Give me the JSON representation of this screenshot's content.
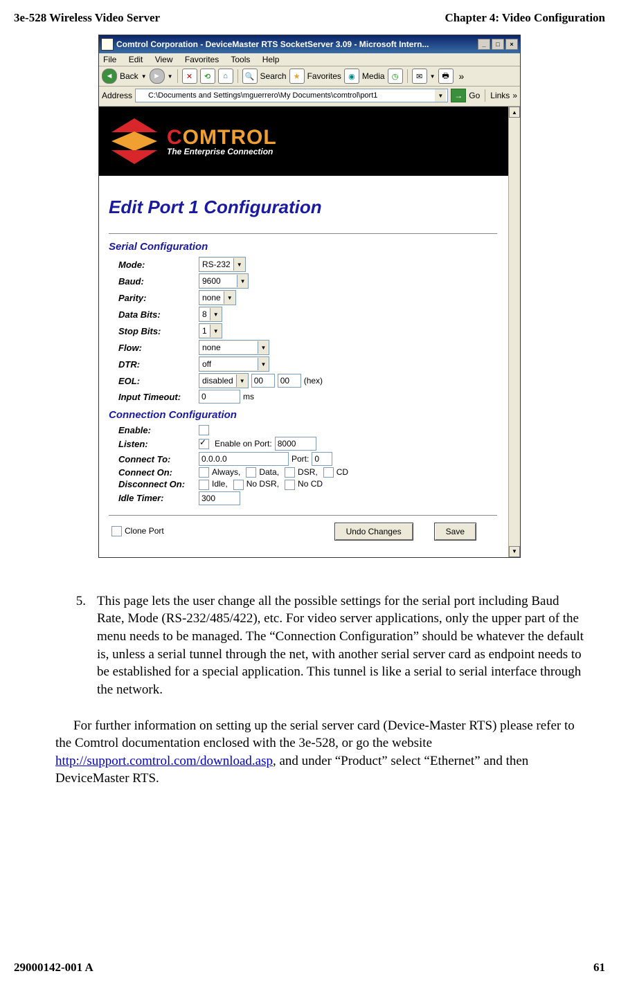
{
  "header": {
    "left": "3e-528 Wireless Video Server",
    "right": "Chapter 4: Video Configuration"
  },
  "browser": {
    "title": "Comtrol Corporation - DeviceMaster RTS SocketServer 3.09 - Microsoft Intern...",
    "menus": [
      "File",
      "Edit",
      "View",
      "Favorites",
      "Tools",
      "Help"
    ],
    "toolbar": {
      "back": "Back",
      "search": "Search",
      "favorites": "Favorites",
      "media": "Media"
    },
    "address": {
      "label": "Address",
      "value": "C:\\Documents and Settings\\mguerrero\\My Documents\\comtrol\\port1",
      "go": "Go",
      "links": "Links"
    }
  },
  "logo": {
    "brand": "COMTROL",
    "tagline": "The Enterprise Connection"
  },
  "form": {
    "heading": "Edit Port 1 Configuration",
    "section_serial": "Serial Configuration",
    "mode": {
      "label": "Mode:",
      "value": "RS-232"
    },
    "baud": {
      "label": "Baud:",
      "value": "9600"
    },
    "parity": {
      "label": "Parity:",
      "value": "none"
    },
    "databits": {
      "label": "Data Bits:",
      "value": "8"
    },
    "stopbits": {
      "label": "Stop Bits:",
      "value": "1"
    },
    "flow": {
      "label": "Flow:",
      "value": "none"
    },
    "dtr": {
      "label": "DTR:",
      "value": "off"
    },
    "eol": {
      "label": "EOL:",
      "value": "disabled",
      "hex1": "00",
      "hex2": "00",
      "suffix": "(hex)"
    },
    "timeout": {
      "label": "Input Timeout:",
      "value": "0",
      "suffix": "ms"
    },
    "section_conn": "Connection Configuration",
    "enable": {
      "label": "Enable:"
    },
    "listen": {
      "label": "Listen:",
      "cb_label": "Enable on Port:",
      "port": "8000"
    },
    "connect_to": {
      "label": "Connect To:",
      "ip": "0.0.0.0",
      "port_label": "Port:",
      "port": "0"
    },
    "connect_on": {
      "label": "Connect On:",
      "o1": "Always,",
      "o2": "Data,",
      "o3": "DSR,",
      "o4": "CD"
    },
    "disconnect_on": {
      "label": "Disconnect On:",
      "o1": "Idle,",
      "o2": "No DSR,",
      "o3": "No CD"
    },
    "idle": {
      "label": "Idle Timer:",
      "value": "300"
    },
    "clone": "Clone Port",
    "undo": "Undo Changes",
    "save": "Save"
  },
  "paragraph5": {
    "num": "5.",
    "text": "This page lets the user change all the possible settings for the serial port including Baud Rate, Mode (RS-232/485/422), etc. For video server applications, only the upper part of the menu needs to be managed. The “Connection Configuration” should be whatever the default is, unless a serial tunnel through the net, with another serial server card as endpoint needs to be established for a special application. This tunnel is like a serial to serial interface through the network."
  },
  "para_end": {
    "pre": "For further information on setting up the serial server card (Device-Master RTS) please refer to the Comtrol documentation enclosed with the 3e-528, or go the website ",
    "link": "http://support.comtrol.com/download.asp",
    "post": ", and under “Product” select “Ethernet” and then DeviceMaster RTS."
  },
  "footer": {
    "left": "29000142-001 A",
    "right": "61"
  }
}
